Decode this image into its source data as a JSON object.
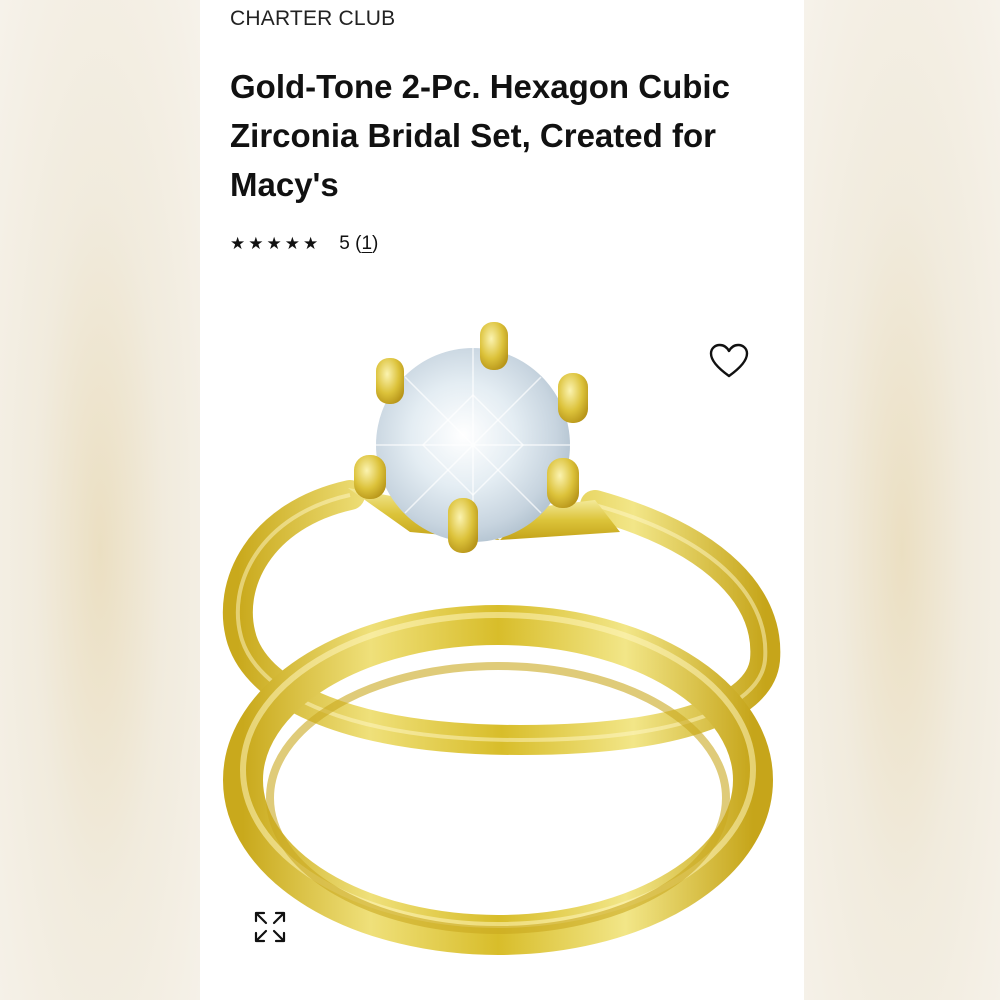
{
  "product": {
    "brand": "CHARTER CLUB",
    "title": "Gold-Tone 2-Pc. Hexagon Cubic Zirconia Bridal Set, Created for Macy's",
    "rating": {
      "stars": 5,
      "star_glyph": "★",
      "score": "5",
      "open_paren": "(",
      "review_count": "1",
      "close_paren": ")"
    }
  },
  "image": {
    "subject": "gold-tone solitaire ring and band",
    "metal_color": "#e6d03a",
    "stone_color": "#dbe6ee"
  },
  "actions": {
    "wishlist_icon": "heart-outline-icon",
    "expand_icon": "expand-arrows-icon"
  },
  "colors": {
    "text": "#111111",
    "panel_bg": "#ffffff",
    "side_bg": "#efe7d6"
  }
}
